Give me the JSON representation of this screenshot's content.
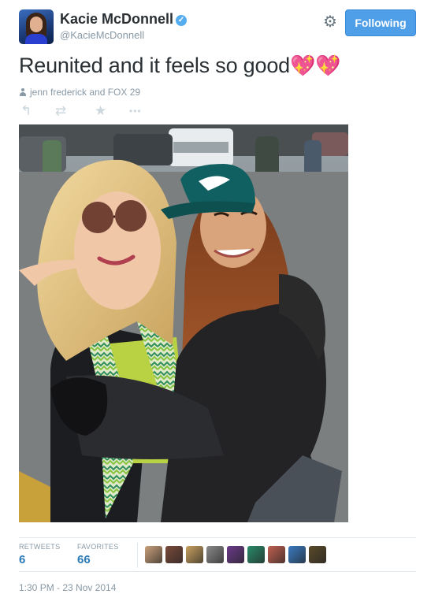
{
  "user": {
    "name": "Kacie McDonnell",
    "handle": "@KacieMcDonnell",
    "verified_glyph": "✓",
    "avatar_icon": "profile-avatar"
  },
  "header": {
    "gear_icon": "gear-icon",
    "gear_glyph": "⚙",
    "follow_label": "Following",
    "follow_color": "#4e9ee8"
  },
  "tweet": {
    "text": "Reunited and it feels so good",
    "emoji": [
      "💖",
      "💖"
    ],
    "context": "jenn frederick and FOX 29"
  },
  "actions": {
    "reply": "↰",
    "retweet": "⇄",
    "favorite": "★",
    "more": "•••"
  },
  "stats": {
    "retweets_label": "RETWEETS",
    "retweets_value": "6",
    "favorites_label": "FAVORITES",
    "favorites_value": "66",
    "favoriter_avatar_colors": [
      "#c9a07a",
      "#7a4a3a",
      "#c8a060",
      "#8a8a8a",
      "#6a3a8a",
      "#2a8a6a",
      "#c06050",
      "#3a7ac0",
      "#5a4a2a"
    ]
  },
  "timestamp": "1:30 PM - 23 Nov 2014",
  "colors": {
    "accent": "#2b7bb9",
    "muted": "#8899a6",
    "text": "#292f33"
  }
}
